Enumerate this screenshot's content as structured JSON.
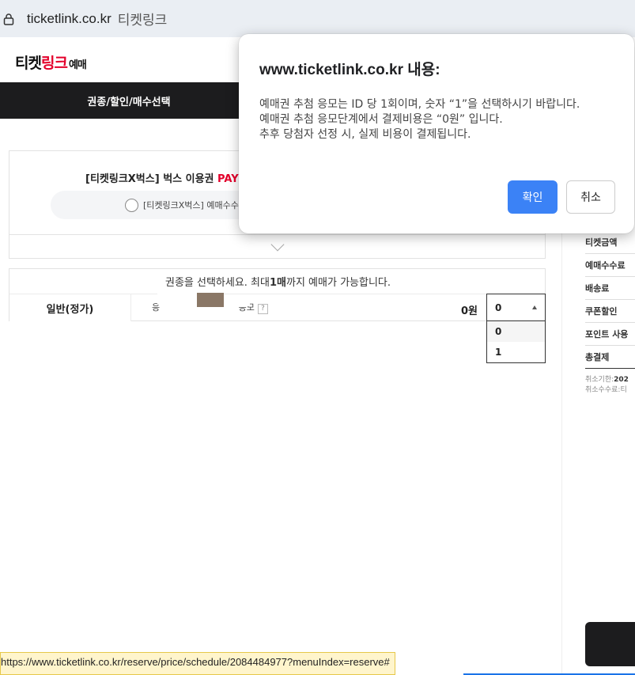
{
  "browser": {
    "url": "ticketlink.co.kr",
    "site_name": "티켓링크"
  },
  "header": {
    "logo_part1": "티켓",
    "logo_part2": "링크",
    "logo_part3": "예매"
  },
  "nav": {
    "tab1": "권종/할인/매수선택"
  },
  "product": {
    "title_prefix": "[티켓링크X벅스] 벅스 이용권 ",
    "title_pay": "PAY",
    "option_label": "[티켓링크X벅스] 예매수수"
  },
  "ticket_select": {
    "instruction_prefix": "권종을 선택하세요. 최대 ",
    "instruction_bold": "1매",
    "instruction_suffix": "까지 예매가 가능합니다.",
    "row_label": "일반(정가)",
    "row_desc_a": "응",
    "row_desc_b": "응모",
    "help": "?",
    "price": "0원",
    "quantity_selected": "0",
    "quantity_options": [
      "0",
      "1"
    ]
  },
  "summary": {
    "rows": [
      "티켓금액",
      "예매수수료",
      "배송료",
      "쿠폰할인",
      "포인트 사용",
      "총결제"
    ],
    "cancel_deadline_label": "취소기한:",
    "cancel_deadline_value": "202",
    "cancel_fee_label": "취소수수료:",
    "cancel_fee_value": "티"
  },
  "dialog": {
    "title": "www.ticketlink.co.kr 내용:",
    "line1": "예매권 추첨 응모는 ID 당 1회이며, 숫자 “1”을 선택하시기 바랍니다.",
    "line2": "예매권 추첨 응모단계에서 결제비용은 “0원” 입니다.",
    "line3": "추후 당첨자 선정 시, 실제 비용이 결제됩니다.",
    "ok_label": "확인",
    "cancel_label": "취소"
  },
  "status_bar": {
    "link": "https://www.ticketlink.co.kr/reserve/price/schedule/2084484977?menuIndex=reserve#"
  }
}
